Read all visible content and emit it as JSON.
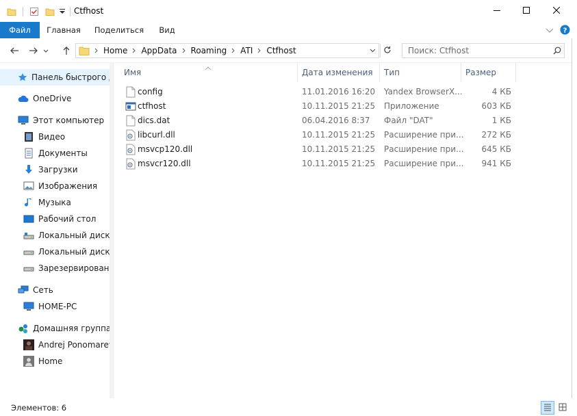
{
  "window": {
    "title": "Ctfhost"
  },
  "ribbon": {
    "tabs": [
      "Файл",
      "Главная",
      "Поделиться",
      "Вид"
    ]
  },
  "address": {
    "crumbs": [
      "Home",
      "AppData",
      "Roaming",
      "ATI",
      "Ctfhost"
    ],
    "search_placeholder": "Поиск: Ctfhost"
  },
  "nav": {
    "items": [
      {
        "label": "Панель быстрого до",
        "icon": "star-icon"
      },
      {
        "label": "OneDrive",
        "icon": "cloud-icon"
      },
      {
        "label": "Этот компьютер",
        "icon": "computer-icon"
      },
      {
        "label": "Видео",
        "icon": "video-icon"
      },
      {
        "label": "Документы",
        "icon": "documents-icon"
      },
      {
        "label": "Загрузки",
        "icon": "downloads-icon"
      },
      {
        "label": "Изображения",
        "icon": "pictures-icon"
      },
      {
        "label": "Музыка",
        "icon": "music-icon"
      },
      {
        "label": "Рабочий стол",
        "icon": "desktop-icon"
      },
      {
        "label": "Локальный диск (C",
        "icon": "drive-c-icon"
      },
      {
        "label": "Локальный диск (D",
        "icon": "drive-icon"
      },
      {
        "label": "Зарезервировано с",
        "icon": "drive-icon"
      },
      {
        "label": "Сеть",
        "icon": "network-icon"
      },
      {
        "label": "HOME-PC",
        "icon": "pc-icon"
      },
      {
        "label": "Домашняя группа",
        "icon": "homegroup-icon"
      },
      {
        "label": "Andrej Ponomarev",
        "icon": "user-photo-icon"
      },
      {
        "label": "Home",
        "icon": "user-icon"
      }
    ]
  },
  "columns": {
    "name": "Имя",
    "date": "Дата изменения",
    "type": "Тип",
    "size": "Размер"
  },
  "files": [
    {
      "name": "config",
      "date": "11.01.2016 16:20",
      "type": "Yandex BrowserX...",
      "size": "4 КБ",
      "icon": "file-icon"
    },
    {
      "name": "ctfhost",
      "date": "10.11.2015 21:25",
      "type": "Приложение",
      "size": "603 КБ",
      "icon": "exe-icon"
    },
    {
      "name": "dics.dat",
      "date": "06.04.2016 8:37",
      "type": "Файл \"DAT\"",
      "size": "1 КБ",
      "icon": "file-icon"
    },
    {
      "name": "libcurl.dll",
      "date": "10.11.2015 21:25",
      "type": "Расширение при...",
      "size": "272 КБ",
      "icon": "dll-icon"
    },
    {
      "name": "msvcp120.dll",
      "date": "10.11.2015 21:25",
      "type": "Расширение при...",
      "size": "645 КБ",
      "icon": "dll-icon"
    },
    {
      "name": "msvcr120.dll",
      "date": "10.11.2015 21:25",
      "type": "Расширение при...",
      "size": "941 КБ",
      "icon": "dll-icon"
    }
  ],
  "status": {
    "count_text": "Элементов: 6"
  },
  "colors": {
    "accent": "#1979ca",
    "selected": "#e5f3ff",
    "folder": "#f8d775"
  }
}
